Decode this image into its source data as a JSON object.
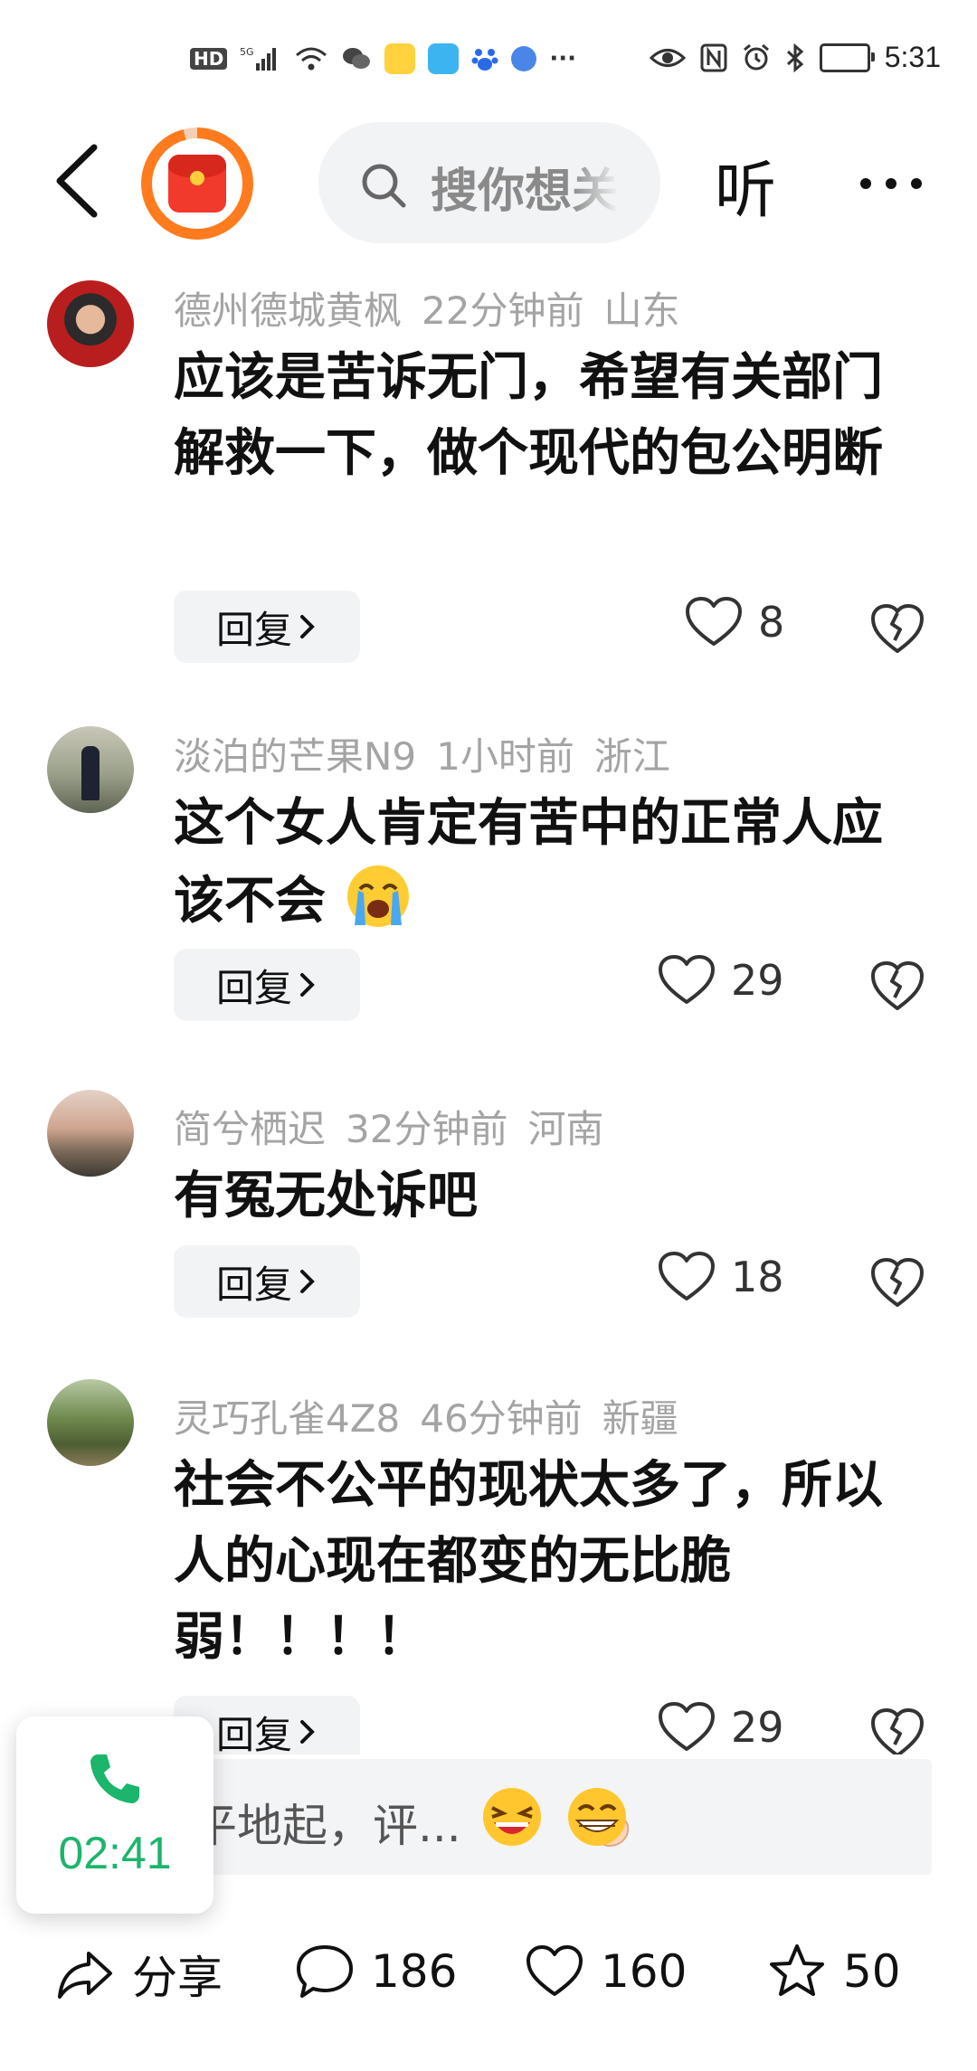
{
  "status_bar": {
    "left_icons": [
      "hd-icon",
      "5g-signal-icon",
      "wifi-icon",
      "wechat-icon",
      "weibo-icon",
      "app-icon",
      "baidu-icon",
      "app-icon-2",
      "more-dots"
    ],
    "right_icons": [
      "eye-icon",
      "nfc-icon",
      "alarm-icon",
      "bluetooth-icon",
      "battery-icon"
    ],
    "time": "5:31"
  },
  "top_nav": {
    "search_placeholder": "搜你想关",
    "listen_label": "听"
  },
  "comments": [
    {
      "user": "德州德城黄枫",
      "time": "22分钟前",
      "location": "山东",
      "text": "应该是苦诉无门，希望有关部门解救一下，做个现代的包公明断",
      "reply_label": "回复",
      "likes": "8"
    },
    {
      "user": "淡泊的芒果N9",
      "time": "1小时前",
      "location": "浙江",
      "text": "这个女人肯定有苦中的正常人应该不会",
      "reply_label": "回复",
      "likes": "29"
    },
    {
      "user": "简兮栖迟",
      "time": "32分钟前",
      "location": "河南",
      "text": "有冤无处诉吧",
      "reply_label": "回复",
      "likes": "18"
    },
    {
      "user": "灵巧孔雀4Z8",
      "time": "46分钟前",
      "location": "新疆",
      "text": "社会不公平的现状太多了，所以人的心现在都变的无比脆弱！！！！",
      "reply_label": "回复",
      "likes": "29"
    }
  ],
  "comment_input": {
    "placeholder": "平地起，评...",
    "emojis": [
      "finger-heart-emoji",
      "laughing-emoji",
      "grinning-emoji"
    ]
  },
  "call_overlay": {
    "duration": "02:41"
  },
  "action_bar": {
    "share_label": "分享",
    "comment_count": "186",
    "like_count": "160",
    "favorite_count": "50"
  },
  "colors": {
    "accent_orange": "#ff7b1e",
    "call_green": "#1bb56b",
    "meta_gray": "#a4a4a4",
    "pill_bg": "#f2f3f5"
  }
}
